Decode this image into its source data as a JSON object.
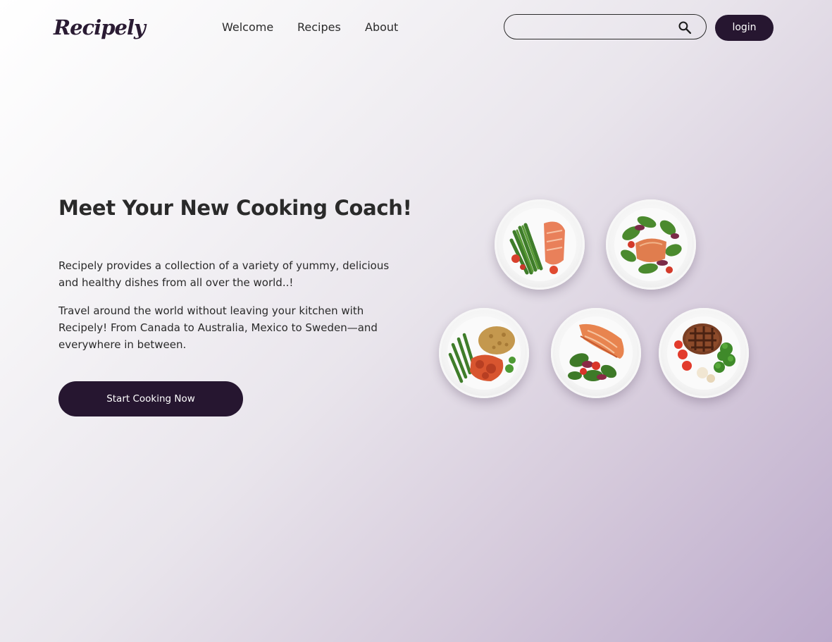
{
  "brand": {
    "logo_text": "Recipely"
  },
  "nav": {
    "links": [
      {
        "label": "Welcome"
      },
      {
        "label": "Recipes"
      },
      {
        "label": "About"
      }
    ]
  },
  "search": {
    "value": "",
    "placeholder": ""
  },
  "header": {
    "login_label": "login"
  },
  "hero": {
    "title": "Meet Your New Cooking Coach!",
    "paragraph_1": "Recipely provides a collection of a variety of yummy, delicious and healthy dishes from all over the world..!",
    "paragraph_2": "Travel around the world without leaving your kitchen with Recipely! From Canada to Australia, Mexico to Sweden—and everywhere in between.",
    "cta_label": "Start Cooking Now"
  },
  "dishes": [
    {
      "icon": "salmon-asparagus-plate-image"
    },
    {
      "icon": "salmon-salad-plate-image"
    },
    {
      "icon": "chicken-rice-greenbeans-plate-image"
    },
    {
      "icon": "salmon-greens-plate-image"
    },
    {
      "icon": "steak-broccoli-plate-image"
    }
  ],
  "colors": {
    "primary": "#261630",
    "text": "#2a2a2a",
    "gradient_end": "#bcaacb"
  }
}
